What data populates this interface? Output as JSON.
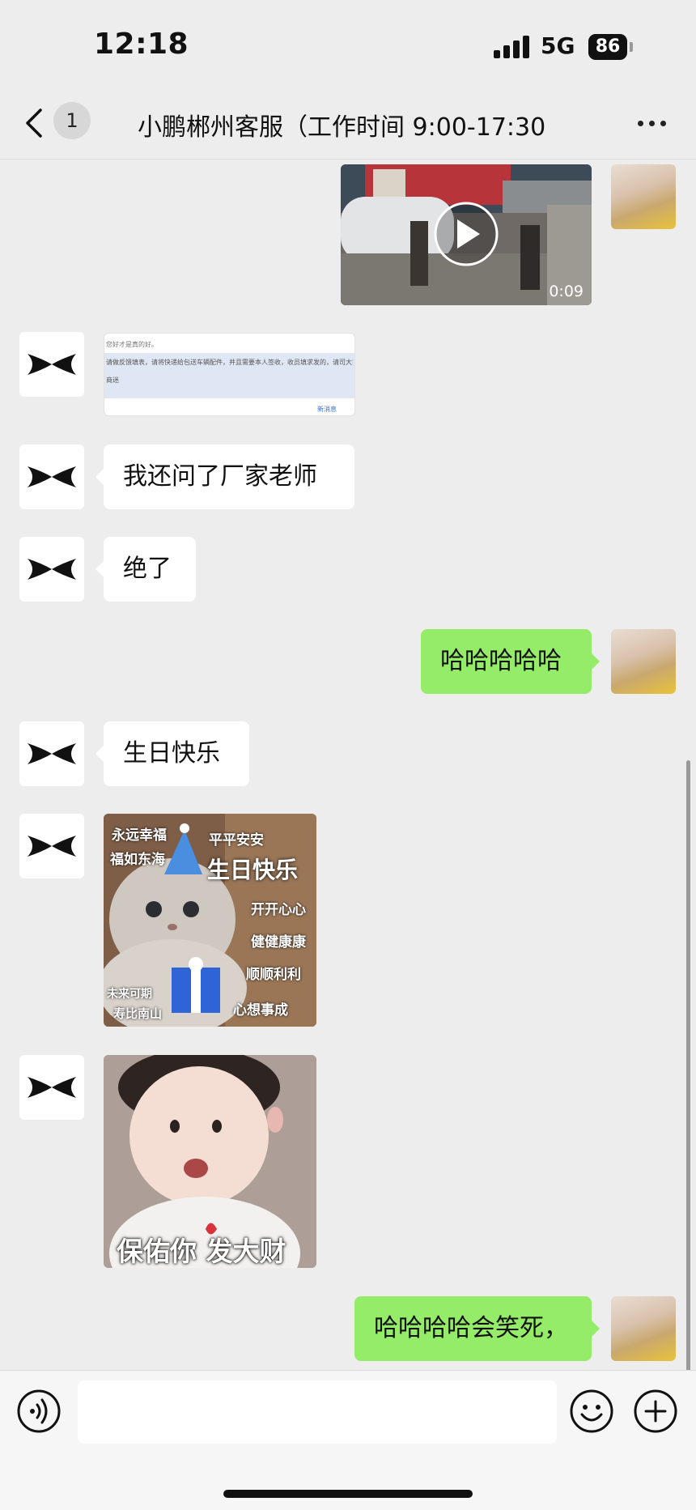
{
  "status_bar": {
    "time": "12:18",
    "network": "5G",
    "battery": "86"
  },
  "nav": {
    "unread_count": "1",
    "title": "小鹏郴州客服（工作时间 9:00-17:30",
    "back_icon": "chevron-left-icon",
    "more_icon": "more-dots-icon"
  },
  "messages": [
    {
      "side": "right",
      "type": "video",
      "duration": "0:09"
    },
    {
      "side": "left",
      "type": "image",
      "text_lines": [
        "您好才是真的好。",
        "请做反馈填表，请将快递给包送车辆配件，并且需要本人签收，收员填求发的，请司大家都知道这",
        "商迷"
      ],
      "footer": "新消息"
    },
    {
      "side": "left",
      "type": "text",
      "text": "我还问了厂家老师"
    },
    {
      "side": "left",
      "type": "text",
      "text": "绝了"
    },
    {
      "side": "right",
      "type": "text",
      "text": "哈哈哈哈哈"
    },
    {
      "side": "left",
      "type": "text",
      "text": "生日快乐"
    },
    {
      "side": "left",
      "type": "sticker",
      "captions": [
        "永远幸福",
        "福如东海",
        "平平安安",
        "生日快乐",
        "开开心心",
        "健健康康",
        "顺顺利利",
        "未来可期",
        "寿比南山",
        "心想事成"
      ]
    },
    {
      "side": "left",
      "type": "sticker",
      "caption": "保佑你 发大财"
    },
    {
      "side": "right",
      "type": "text",
      "text": "哈哈哈哈会笑死，"
    }
  ],
  "input_bar": {
    "placeholder": "",
    "voice_icon": "voice-icon",
    "emoji_icon": "emoji-icon",
    "plus_icon": "plus-icon"
  },
  "colors": {
    "background": "#ededed",
    "my_bubble": "#95ec69",
    "their_bubble": "#ffffff"
  }
}
